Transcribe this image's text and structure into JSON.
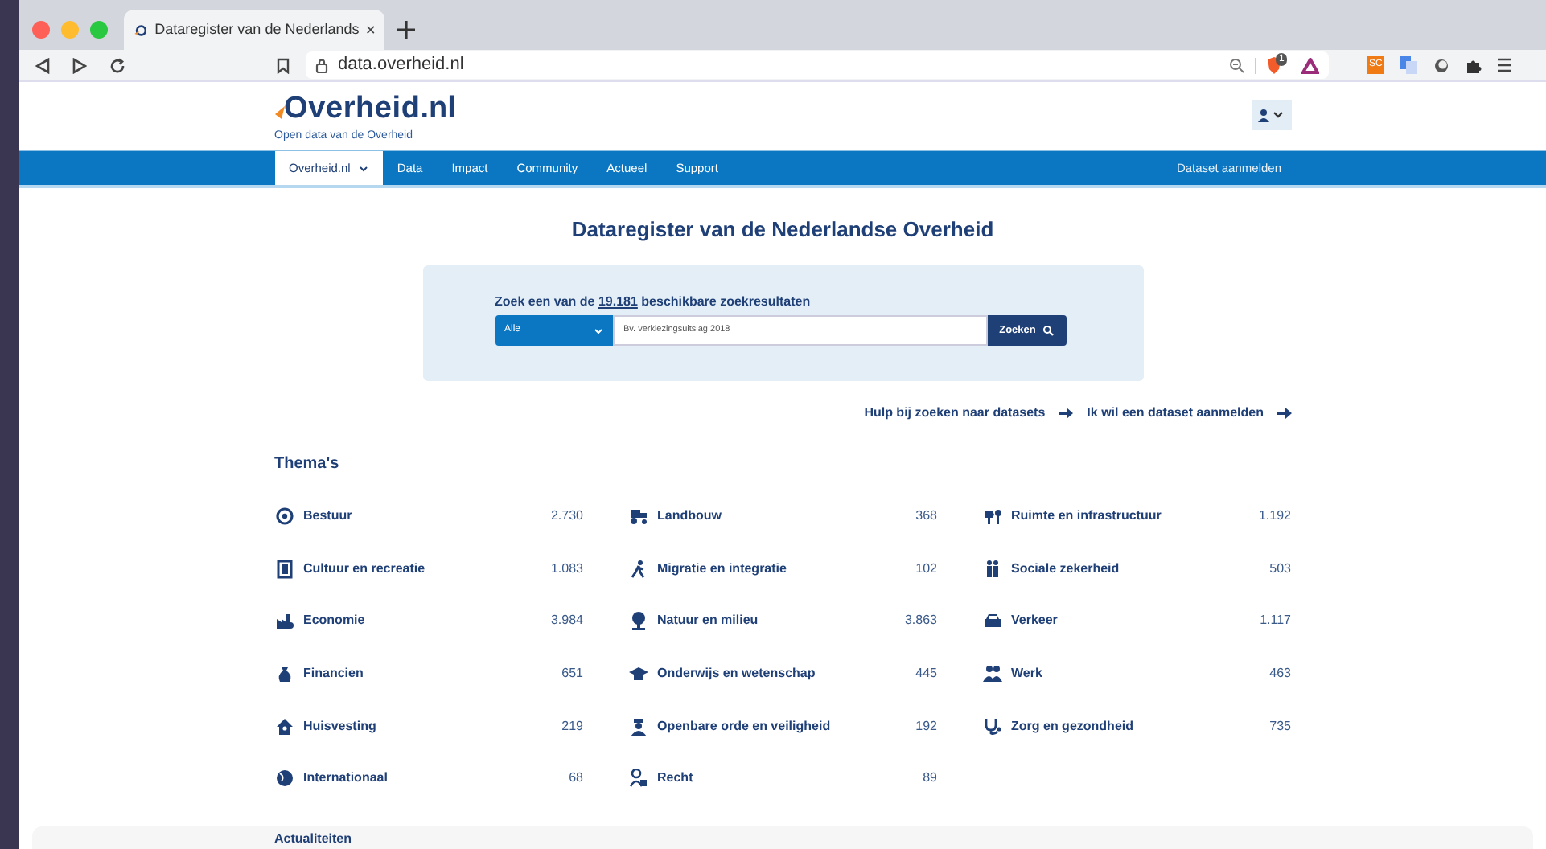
{
  "browser": {
    "tab_title": "Dataregister van de Nederlands",
    "url": "data.overheid.nl",
    "shield_badge": "1",
    "extension_label": "SC"
  },
  "site": {
    "logo": "Overheid",
    "logo_suffix": ".nl",
    "tagline": "Open data van de Overheid"
  },
  "nav": {
    "items": [
      {
        "label": "Overheid.nl",
        "selected": true,
        "dropdown": true
      },
      {
        "label": "Data",
        "selected": false,
        "dropdown": false
      },
      {
        "label": "Impact",
        "selected": false,
        "dropdown": false
      },
      {
        "label": "Community",
        "selected": false,
        "dropdown": false
      },
      {
        "label": "Actueel",
        "selected": false,
        "dropdown": false
      },
      {
        "label": "Support",
        "selected": false,
        "dropdown": false
      }
    ],
    "right_link": "Dataset aanmelden"
  },
  "heading": "Dataregister van de Nederlandse Overheid",
  "search": {
    "intro_before": "Zoek een van de",
    "count_link": "19.181",
    "intro_after": "beschikbare zoekresultaten",
    "category": "Alle",
    "placeholder": "Bv. verkiezingsuitslag 2018",
    "button": "Zoeken"
  },
  "links": [
    "Hulp bij zoeken naar datasets",
    "Ik wil een dataset aanmelden"
  ],
  "themes": {
    "title": "Thema's",
    "columns": [
      [
        {
          "label": "Bestuur",
          "count": "2.730"
        },
        {
          "label": "Cultuur en recreatie",
          "count": "1.083"
        },
        {
          "label": "Economie",
          "count": "3.984"
        },
        {
          "label": "Financien",
          "count": "651"
        },
        {
          "label": "Huisvesting",
          "count": "219"
        },
        {
          "label": "Internationaal",
          "count": "68"
        }
      ],
      [
        {
          "label": "Landbouw",
          "count": "368"
        },
        {
          "label": "Migratie en integratie",
          "count": "102"
        },
        {
          "label": "Natuur en milieu",
          "count": "3.863"
        },
        {
          "label": "Onderwijs en wetenschap",
          "count": "445"
        },
        {
          "label": "Openbare orde en veiligheid",
          "count": "192"
        },
        {
          "label": "Recht",
          "count": "89"
        }
      ],
      [
        {
          "label": "Ruimte en infrastructuur",
          "count": "1.192"
        },
        {
          "label": "Sociale zekerheid",
          "count": "503"
        },
        {
          "label": "Verkeer",
          "count": "1.117"
        },
        {
          "label": "Werk",
          "count": "463"
        },
        {
          "label": "Zorg en gezondheid",
          "count": "735"
        }
      ]
    ]
  },
  "news": {
    "title": "Actualiteiten"
  }
}
